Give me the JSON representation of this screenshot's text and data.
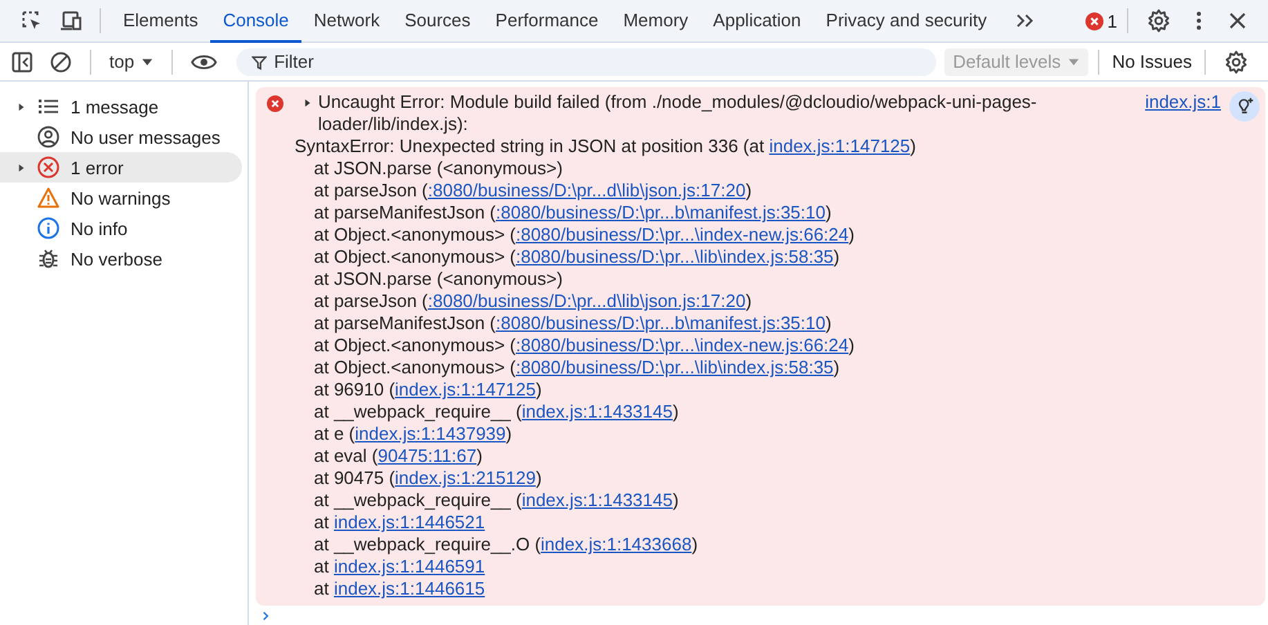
{
  "tabs": [
    {
      "label": "Elements",
      "selected": false
    },
    {
      "label": "Console",
      "selected": true
    },
    {
      "label": "Network",
      "selected": false
    },
    {
      "label": "Sources",
      "selected": false
    },
    {
      "label": "Performance",
      "selected": false
    },
    {
      "label": "Memory",
      "selected": false
    },
    {
      "label": "Application",
      "selected": false
    },
    {
      "label": "Privacy and security",
      "selected": false
    }
  ],
  "error_count": "1",
  "console_toolbar": {
    "context": "top",
    "filter": {
      "placeholder": "Filter"
    },
    "levels": {
      "label": "Default levels",
      "disabled": true
    },
    "issues": "No Issues"
  },
  "sidebar": {
    "items": [
      {
        "kind": "list",
        "label": "1 message",
        "expandable": true,
        "selected": false
      },
      {
        "kind": "user",
        "label": "No user messages",
        "expandable": false,
        "selected": false
      },
      {
        "kind": "error",
        "label": "1 error",
        "expandable": true,
        "selected": true
      },
      {
        "kind": "warning",
        "label": "No warnings",
        "expandable": false,
        "selected": false
      },
      {
        "kind": "info",
        "label": "No info",
        "expandable": false,
        "selected": false
      },
      {
        "kind": "verbose",
        "label": "No verbose",
        "expandable": false,
        "selected": false
      }
    ]
  },
  "message": {
    "kind": "error",
    "expanded": false,
    "title": "Uncaught Error: Module build failed (from ./node_modules/@dcloudio/webpack-uni-pages-loader/lib/index.js):",
    "source": "index.js:1",
    "detail": {
      "prefix": "SyntaxError: Unexpected string in JSON at position 336 (at ",
      "link": "index.js:1:147125",
      "suffix": ")"
    },
    "stack": [
      {
        "prefix": "at JSON.parse (<anonymous>)"
      },
      {
        "prefix": "at parseJson (",
        "link": ":8080/business/D:\\pr...d\\lib\\json.js:17:20",
        "suffix": ")"
      },
      {
        "prefix": "at parseManifestJson (",
        "link": ":8080/business/D:\\pr...b\\manifest.js:35:10",
        "suffix": ")"
      },
      {
        "prefix": "at Object.<anonymous> (",
        "link": ":8080/business/D:\\pr...\\index-new.js:66:24",
        "suffix": ")"
      },
      {
        "prefix": "at Object.<anonymous> (",
        "link": ":8080/business/D:\\pr...\\lib\\index.js:58:35",
        "suffix": ")"
      },
      {
        "prefix": "at JSON.parse (<anonymous>)"
      },
      {
        "prefix": "at parseJson (",
        "link": ":8080/business/D:\\pr...d\\lib\\json.js:17:20",
        "suffix": ")"
      },
      {
        "prefix": "at parseManifestJson (",
        "link": ":8080/business/D:\\pr...b\\manifest.js:35:10",
        "suffix": ")"
      },
      {
        "prefix": "at Object.<anonymous> (",
        "link": ":8080/business/D:\\pr...\\index-new.js:66:24",
        "suffix": ")"
      },
      {
        "prefix": "at Object.<anonymous> (",
        "link": ":8080/business/D:\\pr...\\lib\\index.js:58:35",
        "suffix": ")"
      },
      {
        "prefix": "at 96910 (",
        "link": "index.js:1:147125",
        "suffix": ")"
      },
      {
        "prefix": "at __webpack_require__ (",
        "link": "index.js:1:1433145",
        "suffix": ")"
      },
      {
        "prefix": "at e (",
        "link": "index.js:1:1437939",
        "suffix": ")"
      },
      {
        "prefix": "at eval (",
        "link": "90475:11:67",
        "suffix": ")"
      },
      {
        "prefix": "at 90475 (",
        "link": "index.js:1:215129",
        "suffix": ")"
      },
      {
        "prefix": "at __webpack_require__ (",
        "link": "index.js:1:1433145",
        "suffix": ")"
      },
      {
        "prefix": "at ",
        "link": "index.js:1:1446521"
      },
      {
        "prefix": "at __webpack_require__.O (",
        "link": "index.js:1:1433668",
        "suffix": ")"
      },
      {
        "prefix": "at ",
        "link": "index.js:1:1446591"
      },
      {
        "prefix": "at ",
        "link": "index.js:1:1446615"
      }
    ]
  }
}
